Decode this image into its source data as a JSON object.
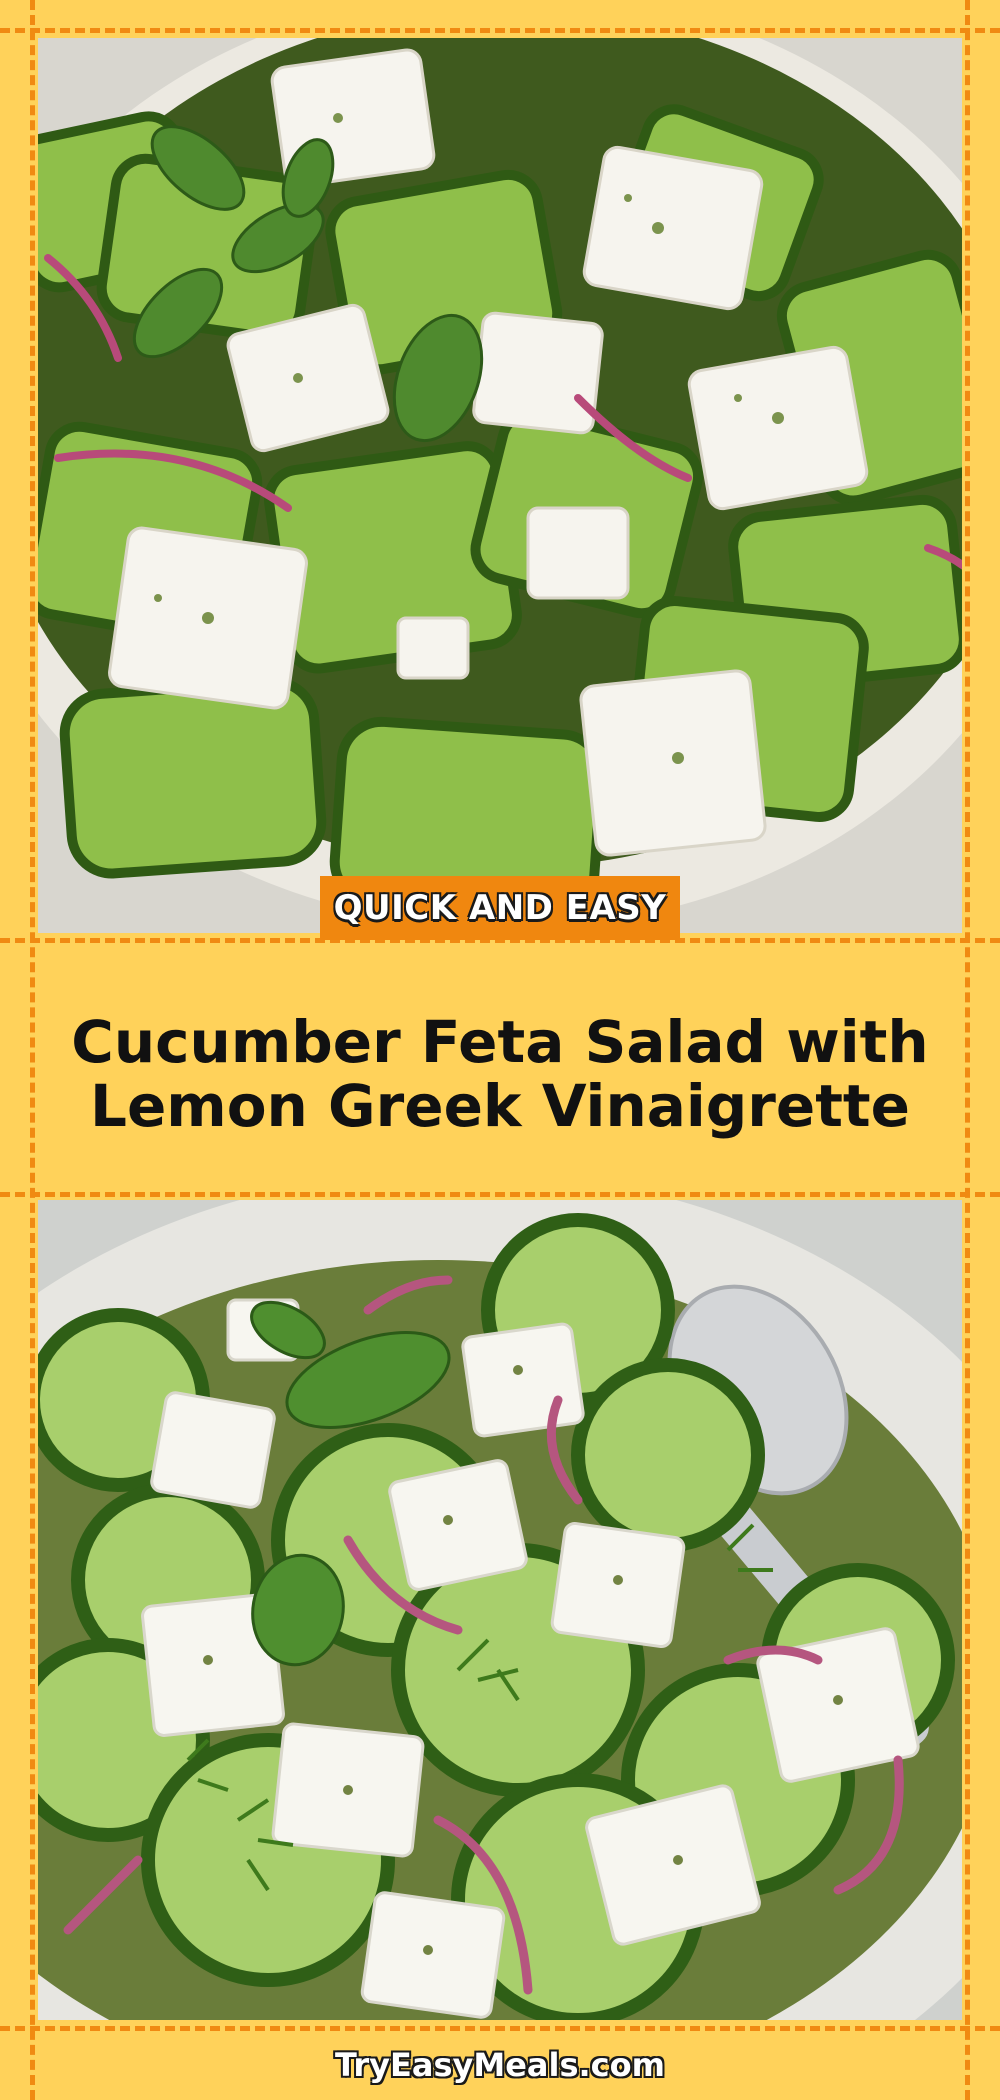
{
  "badge": {
    "text": "QUICK AND EASY"
  },
  "title": {
    "line1": "Cucumber Feta Salad with",
    "line2": "Lemon Greek Vinaigrette"
  },
  "footer": {
    "site": "TryEasyMeals.com"
  },
  "photos": {
    "top": {
      "subject": "cucumber-feta-salad-with-mint-photo"
    },
    "bottom": {
      "subject": "cucumber-feta-salad-with-dill-and-spoon-photo"
    }
  },
  "colors": {
    "background": "#ffd25a",
    "accent": "#f0870f",
    "title_text": "#111111",
    "footer_text": "#ffffff"
  }
}
